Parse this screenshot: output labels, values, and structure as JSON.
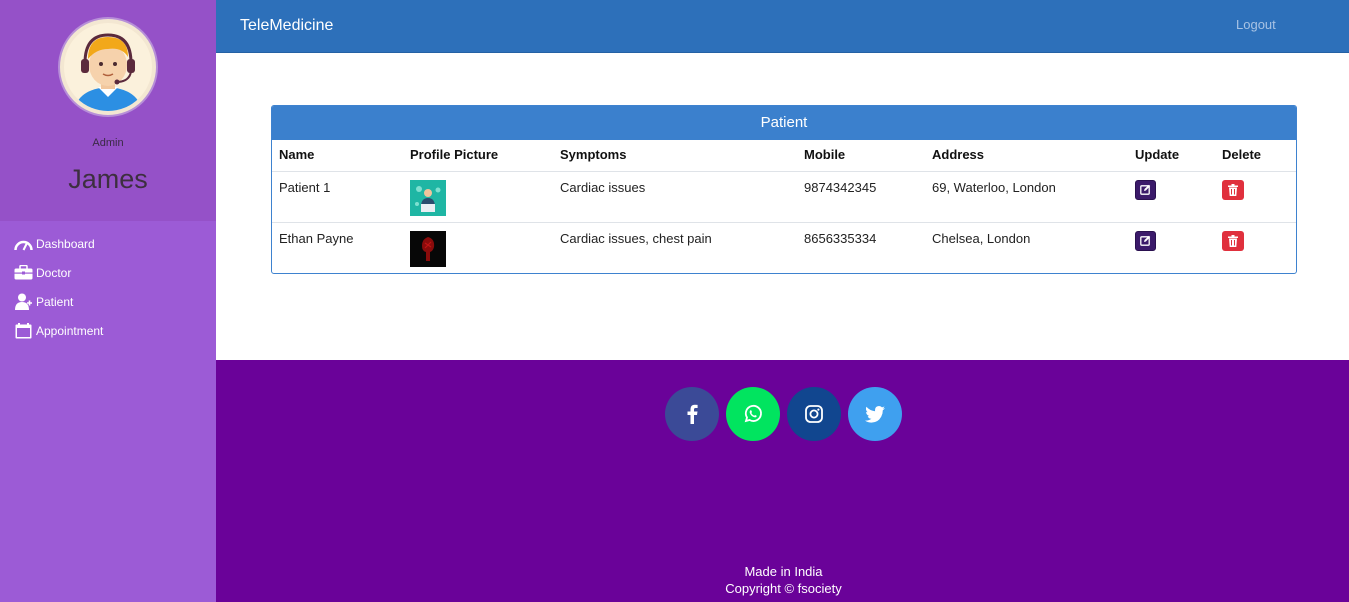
{
  "sidebar": {
    "role": "Admin",
    "username": "James",
    "items": [
      {
        "label": "Dashboard",
        "icon": "dashboard-gauge-icon"
      },
      {
        "label": "Doctor",
        "icon": "briefcase-icon"
      },
      {
        "label": "Patient",
        "icon": "user-patient-icon"
      },
      {
        "label": "Appointment",
        "icon": "calendar-icon"
      }
    ]
  },
  "navbar": {
    "brand": "TeleMedicine",
    "logout": "Logout"
  },
  "patient_table": {
    "title": "Patient",
    "columns": [
      "Name",
      "Profile Picture",
      "Symptoms",
      "Mobile",
      "Address",
      "Update",
      "Delete"
    ],
    "rows": [
      {
        "name": "Patient 1",
        "symptoms": "Cardiac issues",
        "mobile": "9874342345",
        "address": "69, Waterloo, London"
      },
      {
        "name": "Ethan Payne",
        "symptoms": "Cardiac issues, chest pain",
        "mobile": "8656335334",
        "address": "Chelsea, London"
      }
    ]
  },
  "footer": {
    "socials": [
      {
        "name": "facebook-icon",
        "color": "#3b4a97"
      },
      {
        "name": "whatsapp-icon",
        "color": "#01e45f"
      },
      {
        "name": "instagram-icon",
        "color": "#11468f"
      },
      {
        "name": "twitter-icon",
        "color": "#3fa0ef"
      }
    ],
    "made": "Made in India",
    "copyright": "Copyright © fsociety"
  },
  "colors": {
    "sidebar": "#9c5bd6",
    "navbar": "#2d70ba",
    "card_header": "#3b80cd",
    "footer": "#6a0299",
    "update_button": "#3b1a6a",
    "delete_button": "#e0303d"
  }
}
